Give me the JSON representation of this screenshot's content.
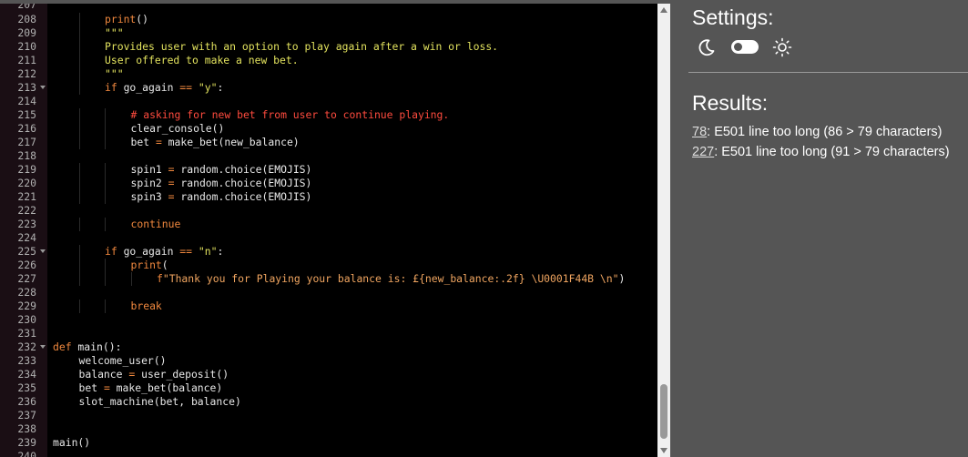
{
  "editor": {
    "lines": [
      {
        "n": "207",
        "partial": true,
        "segs": []
      },
      {
        "n": "208",
        "indent": 2,
        "segs": [
          {
            "t": "print",
            "c": "t-kw"
          },
          {
            "t": "()",
            "c": "t-plain"
          }
        ]
      },
      {
        "n": "209",
        "indent": 2,
        "segs": [
          {
            "t": "\"\"\"",
            "c": "t-str"
          }
        ]
      },
      {
        "n": "210",
        "indent": 2,
        "segs": [
          {
            "t": "Provides user with an option to play again after a win or loss.",
            "c": "t-str"
          }
        ]
      },
      {
        "n": "211",
        "indent": 2,
        "segs": [
          {
            "t": "User offered to make a new bet.",
            "c": "t-str"
          }
        ]
      },
      {
        "n": "212",
        "indent": 2,
        "segs": [
          {
            "t": "\"\"\"",
            "c": "t-str"
          }
        ]
      },
      {
        "n": "213",
        "fold": true,
        "indent": 2,
        "segs": [
          {
            "t": "if",
            "c": "t-kw"
          },
          {
            "t": " go_again ",
            "c": "t-plain"
          },
          {
            "t": "==",
            "c": "t-op"
          },
          {
            "t": " ",
            "c": "t-plain"
          },
          {
            "t": "\"y\"",
            "c": "t-str"
          },
          {
            "t": ":",
            "c": "t-plain"
          }
        ]
      },
      {
        "n": "214",
        "indent": 0,
        "segs": []
      },
      {
        "n": "215",
        "indent": 3,
        "segs": [
          {
            "t": "# asking for new bet from user to continue playing.",
            "c": "t-com"
          }
        ]
      },
      {
        "n": "216",
        "indent": 3,
        "segs": [
          {
            "t": "clear_console()",
            "c": "t-plain"
          }
        ]
      },
      {
        "n": "217",
        "indent": 3,
        "segs": [
          {
            "t": "bet ",
            "c": "t-plain"
          },
          {
            "t": "=",
            "c": "t-op"
          },
          {
            "t": " make_bet(new_balance)",
            "c": "t-plain"
          }
        ]
      },
      {
        "n": "218",
        "indent": 0,
        "segs": []
      },
      {
        "n": "219",
        "indent": 3,
        "segs": [
          {
            "t": "spin1 ",
            "c": "t-plain"
          },
          {
            "t": "=",
            "c": "t-op"
          },
          {
            "t": " random.choice(EMOJIS)",
            "c": "t-plain"
          }
        ]
      },
      {
        "n": "220",
        "indent": 3,
        "segs": [
          {
            "t": "spin2 ",
            "c": "t-plain"
          },
          {
            "t": "=",
            "c": "t-op"
          },
          {
            "t": " random.choice(EMOJIS)",
            "c": "t-plain"
          }
        ]
      },
      {
        "n": "221",
        "indent": 3,
        "segs": [
          {
            "t": "spin3 ",
            "c": "t-plain"
          },
          {
            "t": "=",
            "c": "t-op"
          },
          {
            "t": " random.choice(EMOJIS)",
            "c": "t-plain"
          }
        ]
      },
      {
        "n": "222",
        "indent": 0,
        "segs": []
      },
      {
        "n": "223",
        "indent": 3,
        "segs": [
          {
            "t": "continue",
            "c": "t-kw"
          }
        ]
      },
      {
        "n": "224",
        "indent": 0,
        "segs": []
      },
      {
        "n": "225",
        "fold": true,
        "indent": 2,
        "segs": [
          {
            "t": "if",
            "c": "t-kw"
          },
          {
            "t": " go_again ",
            "c": "t-plain"
          },
          {
            "t": "==",
            "c": "t-op"
          },
          {
            "t": " ",
            "c": "t-plain"
          },
          {
            "t": "\"n\"",
            "c": "t-str"
          },
          {
            "t": ":",
            "c": "t-plain"
          }
        ]
      },
      {
        "n": "226",
        "indent": 3,
        "segs": [
          {
            "t": "print",
            "c": "t-kw"
          },
          {
            "t": "(",
            "c": "t-plain"
          }
        ]
      },
      {
        "n": "227",
        "indent": 4,
        "segs": [
          {
            "t": "f",
            "c": "t-kw"
          },
          {
            "t": "\"Thank you for Playing your balance is: £{new_balance:.2f} \\U0001F44B \\n\"",
            "c": "t-fstr"
          },
          {
            "t": ")",
            "c": "t-plain"
          }
        ]
      },
      {
        "n": "228",
        "indent": 0,
        "segs": []
      },
      {
        "n": "229",
        "indent": 3,
        "segs": [
          {
            "t": "break",
            "c": "t-kw"
          }
        ]
      },
      {
        "n": "230",
        "indent": 0,
        "segs": []
      },
      {
        "n": "231",
        "indent": 0,
        "segs": []
      },
      {
        "n": "232",
        "fold": true,
        "indent": 0,
        "segs": [
          {
            "t": "def",
            "c": "t-kw"
          },
          {
            "t": " main():",
            "c": "t-plain"
          }
        ]
      },
      {
        "n": "233",
        "indent": 1,
        "segs": [
          {
            "t": "welcome_user()",
            "c": "t-plain"
          }
        ]
      },
      {
        "n": "234",
        "indent": 1,
        "segs": [
          {
            "t": "balance ",
            "c": "t-plain"
          },
          {
            "t": "=",
            "c": "t-op"
          },
          {
            "t": " user_deposit()",
            "c": "t-plain"
          }
        ]
      },
      {
        "n": "235",
        "indent": 1,
        "segs": [
          {
            "t": "bet ",
            "c": "t-plain"
          },
          {
            "t": "=",
            "c": "t-op"
          },
          {
            "t": " make_bet(balance)",
            "c": "t-plain"
          }
        ]
      },
      {
        "n": "236",
        "indent": 1,
        "segs": [
          {
            "t": "slot_machine(bet, balance)",
            "c": "t-plain"
          }
        ]
      },
      {
        "n": "237",
        "indent": 0,
        "segs": []
      },
      {
        "n": "238",
        "indent": 0,
        "segs": []
      },
      {
        "n": "239",
        "indent": 0,
        "segs": [
          {
            "t": "main()",
            "c": "t-plain"
          }
        ]
      },
      {
        "n": "240",
        "indent": 0,
        "segs": []
      }
    ]
  },
  "panel": {
    "settings_title": "Settings:",
    "results_title": "Results:",
    "results": [
      {
        "line": "78",
        "message": ": E501 line too long (86 > 79 characters)"
      },
      {
        "line": "227",
        "message": ": E501 line too long (91 > 79 characters)"
      }
    ]
  },
  "icons": {
    "theme_dark": "moon-icon",
    "theme_toggle": "toggle-switch",
    "theme_light": "sun-icon"
  },
  "colors": {
    "editor_bg": "#000000",
    "gutter_bg": "#1a0e14",
    "keyword": "#f0883e",
    "string": "#e2e25e",
    "comment": "#ff4b3e",
    "panel_bg": "#555555"
  }
}
